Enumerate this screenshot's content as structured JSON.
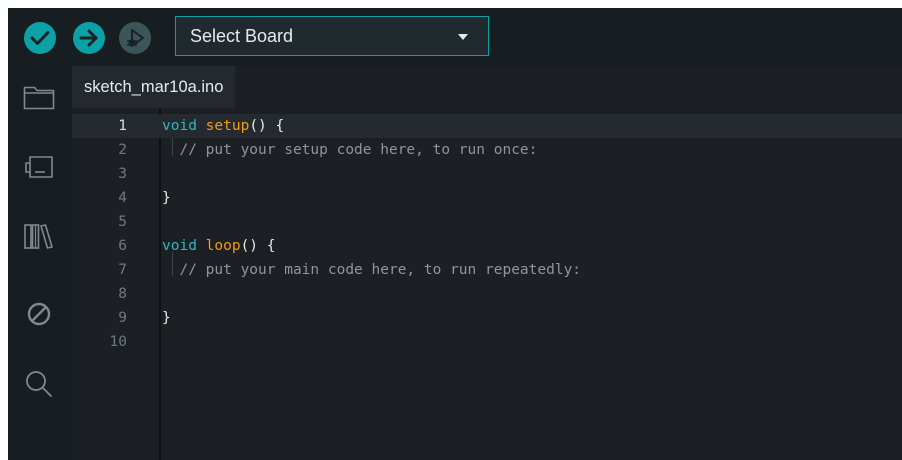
{
  "toolbar": {
    "verify_icon": "checkmark-icon",
    "upload_icon": "arrow-right-icon",
    "debug_icon": "debug-play-icon",
    "board_select": {
      "value": "Select Board",
      "icon": "caret-down-icon"
    },
    "colors": {
      "accent": "#0ca1a6",
      "debug_disabled": "#3b5659"
    }
  },
  "sidebar": {
    "items": [
      {
        "name": "sketchbook",
        "icon": "folder-icon"
      },
      {
        "name": "boards-manager",
        "icon": "board-icon"
      },
      {
        "name": "library-manager",
        "icon": "library-icon"
      },
      {
        "name": "debug",
        "icon": "no-entry-icon"
      },
      {
        "name": "search",
        "icon": "search-icon"
      }
    ]
  },
  "tabs": [
    {
      "label": "sketch_mar10a.ino",
      "active": true
    }
  ],
  "editor": {
    "active_line": 1,
    "lines": [
      {
        "num": "1",
        "tokens": [
          {
            "t": "void ",
            "c": "kw"
          },
          {
            "t": "setup",
            "c": "fn"
          },
          {
            "t": "() {",
            "c": "pn"
          }
        ]
      },
      {
        "num": "2",
        "tokens": [
          {
            "t": "  // put your setup code here, to run once:",
            "c": "cm"
          }
        ]
      },
      {
        "num": "3",
        "tokens": []
      },
      {
        "num": "4",
        "tokens": [
          {
            "t": "}",
            "c": "pn"
          }
        ]
      },
      {
        "num": "5",
        "tokens": []
      },
      {
        "num": "6",
        "tokens": [
          {
            "t": "void ",
            "c": "kw"
          },
          {
            "t": "loop",
            "c": "fn"
          },
          {
            "t": "() {",
            "c": "pn"
          }
        ]
      },
      {
        "num": "7",
        "tokens": [
          {
            "t": "  // put your main code here, to run repeatedly:",
            "c": "cm"
          }
        ]
      },
      {
        "num": "8",
        "tokens": []
      },
      {
        "num": "9",
        "tokens": [
          {
            "t": "}",
            "c": "pn"
          }
        ]
      },
      {
        "num": "10",
        "tokens": []
      }
    ],
    "colors": {
      "keyword": "#2fb7bf",
      "function": "#f39c12",
      "comment": "#8c969b",
      "text": "#e6ecec"
    }
  }
}
